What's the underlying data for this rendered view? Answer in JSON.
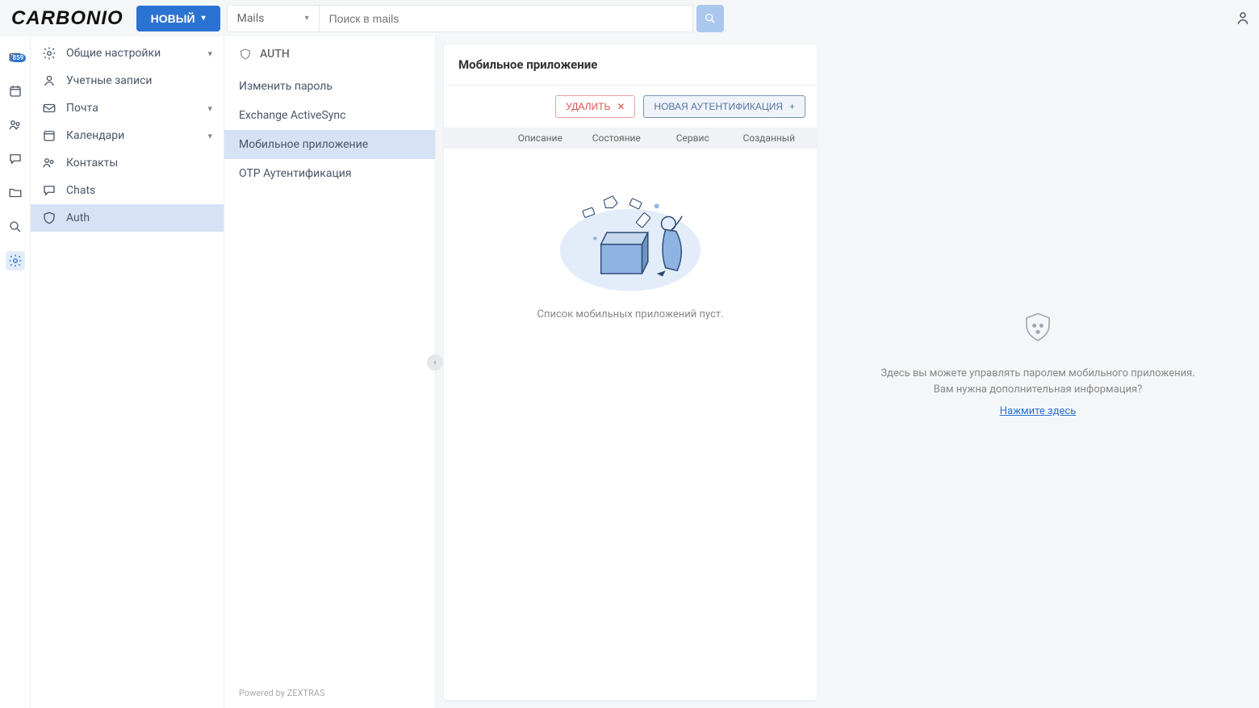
{
  "header": {
    "logo": "CARBONIO",
    "new_button": "НОВЫЙ",
    "search_category": "Mails",
    "search_placeholder": "Поиск в mails"
  },
  "rail": {
    "badge": "859"
  },
  "sidebar": {
    "items": [
      {
        "label": "Общие настройки",
        "expandable": true
      },
      {
        "label": "Учетные записи",
        "expandable": false
      },
      {
        "label": "Почта",
        "expandable": true
      },
      {
        "label": "Календари",
        "expandable": true
      },
      {
        "label": "Контакты",
        "expandable": false
      },
      {
        "label": "Chats",
        "expandable": false
      },
      {
        "label": "Auth",
        "expandable": false
      }
    ]
  },
  "sublist": {
    "title": "AUTH",
    "items": [
      "Изменить пароль",
      "Exchange ActiveSync",
      "Мобильное приложение",
      "OTP Аутентификация"
    ],
    "powered_by": "Powered by ZEXTRAS"
  },
  "center": {
    "title": "Мобильное приложение",
    "delete": "УДАЛИТЬ",
    "new_auth": "НОВАЯ АУТЕНТИФИКАЦИЯ",
    "columns": [
      "",
      "Описание",
      "Состояние",
      "Сервис",
      "Созданный"
    ],
    "empty": "Список мобильных приложений пуст."
  },
  "right": {
    "line1": "Здесь вы можете управлять паролем мобильного приложения.",
    "line2": "Вам нужна дополнительная информация?",
    "link": "Нажмите здесь"
  }
}
